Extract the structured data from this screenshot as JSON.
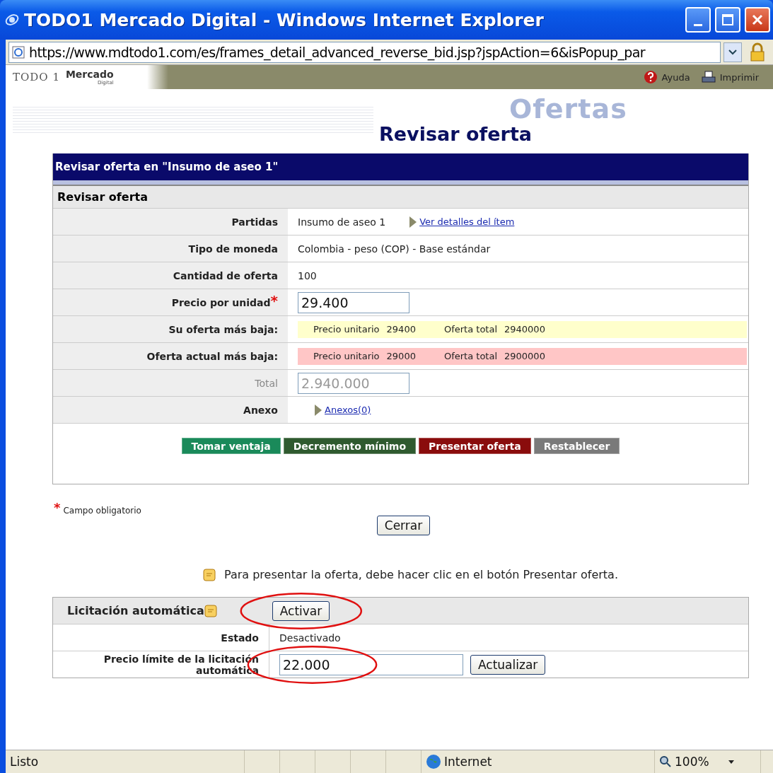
{
  "window": {
    "title": "TODO1 Mercado Digital - Windows Internet Explorer"
  },
  "address_bar": {
    "url": "https://www.mdtodo1.com/es/frames_detail_advanced_reverse_bid.jsp?jspAction=6&isPopup_par"
  },
  "header": {
    "logo": {
      "brand": "TODO 1",
      "name": "Mercado",
      "tagline": "Digital"
    },
    "links": [
      "Ayuda",
      "Imprimir"
    ]
  },
  "banner": {
    "section": "Ofertas",
    "title": "Revisar oferta"
  },
  "panel": {
    "title": "Revisar oferta en \"Insumo de aseo 1\"",
    "section": "Revisar oferta",
    "rows": [
      {
        "kind": "text",
        "label": "Partidas",
        "required": false,
        "value": "Insumo de aseo 1",
        "link": "Ver detalles del ítem"
      },
      {
        "kind": "text",
        "label": "Tipo de moneda",
        "required": false,
        "value": "Colombia - peso (COP) - Base estándar"
      },
      {
        "kind": "text",
        "label": "Cantidad de oferta",
        "required": false,
        "value": "100"
      },
      {
        "kind": "input",
        "label": "Precio por unidad",
        "required": true,
        "value": "29.400",
        "disabled": false
      },
      {
        "kind": "offer",
        "label": "Su oferta más baja:",
        "required": false,
        "color": "#ffffcc",
        "unit_label": "Precio unitario",
        "unit_price": "29400",
        "total_label": "Oferta total",
        "total": "2940000"
      },
      {
        "kind": "offer",
        "label": "Oferta actual más baja:",
        "required": false,
        "color": "#ffc6c6",
        "unit_label": "Precio unitario",
        "unit_price": "29000",
        "total_label": "Oferta total",
        "total": "2900000"
      },
      {
        "kind": "input",
        "label": "Total",
        "required": false,
        "value": "2.940.000",
        "disabled": true
      },
      {
        "kind": "text",
        "label": "Anexo",
        "required": false,
        "link": "Anexos(0)"
      }
    ],
    "buttons": [
      {
        "label": "Tomar ventaja",
        "color": "#1a8a5a"
      },
      {
        "label": "Decremento mínimo",
        "color": "#2f5a2f"
      },
      {
        "label": "Presentar oferta",
        "color": "#8a0c0c"
      },
      {
        "label": "Restablecer",
        "color": "#7a7a7a"
      }
    ]
  },
  "footnote": {
    "mark": "*",
    "text": "Campo obligatorio"
  },
  "close_button": "Cerrar",
  "note": "Para presentar la oferta, debe hacer clic en el botón Presentar oferta.",
  "auto_bid": {
    "title": "Licitación automática",
    "button": {
      "label": "Activar",
      "highlighted": true
    },
    "status_label": "Estado",
    "status": "Desactivado",
    "limit_label": "Precio límite de la licitación automática",
    "limit": {
      "value": "22.000",
      "highlighted": true
    },
    "update_button": "Actualizar"
  },
  "status_bar": {
    "status": "Listo",
    "zone": "Internet",
    "zoom": "100%"
  }
}
